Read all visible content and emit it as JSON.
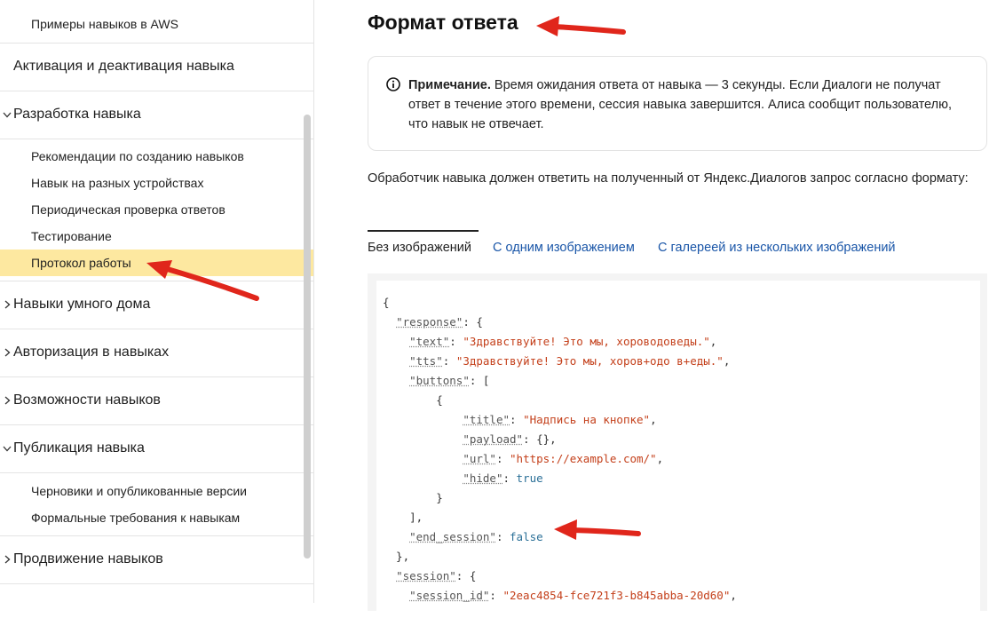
{
  "sidebar": {
    "items": [
      {
        "type": "sub",
        "label": "Примеры навыков в AWS",
        "active": false
      },
      {
        "type": "section",
        "label": "Активация и деактивация навыка",
        "chevron": "none"
      },
      {
        "type": "section",
        "label": "Разработка навыка",
        "chevron": "chevron-down"
      },
      {
        "type": "sub",
        "label": "Рекомендации по созданию навыков",
        "active": false
      },
      {
        "type": "sub",
        "label": "Навык на разных устройствах",
        "active": false
      },
      {
        "type": "sub",
        "label": "Периодическая проверка ответов",
        "active": false
      },
      {
        "type": "sub",
        "label": "Тестирование",
        "active": false
      },
      {
        "type": "sub",
        "label": "Протокол работы",
        "active": true
      },
      {
        "type": "section",
        "label": "Навыки умного дома",
        "chevron": "chevron-right"
      },
      {
        "type": "section",
        "label": "Авторизация в навыках",
        "chevron": "chevron-right"
      },
      {
        "type": "section",
        "label": "Возможности навыков",
        "chevron": "chevron-right"
      },
      {
        "type": "section",
        "label": "Публикация навыка",
        "chevron": "chevron-down"
      },
      {
        "type": "sub",
        "label": "Черновики и опубликованные версии",
        "active": false
      },
      {
        "type": "sub",
        "label": "Формальные требования к навыкам",
        "active": false
      },
      {
        "type": "section",
        "label": "Продвижение навыков",
        "chevron": "chevron-right"
      }
    ]
  },
  "main": {
    "title": "Формат ответа",
    "note": {
      "icon": "info-icon",
      "bold": "Примечание.",
      "text": " Время ожидания ответа от навыка — 3 секунды. Если Диалоги не получат ответ в течение этого времени, сессия навыка завершится. Алиса сообщит пользователю, что навык не отвечает."
    },
    "paragraph": "Обработчик навыка должен ответить на полученный от Яндекс.Диалогов запрос согласно формату:",
    "tabs": [
      "Без изображений",
      "С одним изображением",
      "С галереей из нескольких изображений"
    ],
    "selected_tab": "Без изображений",
    "code": {
      "open_brace": "{",
      "response_key": "\"response\"",
      "text_key": "\"text\"",
      "text_value": "\"Здравствуйте! Это мы, хороводоведы.\"",
      "tts_key": "\"tts\"",
      "tts_value": "\"Здравствуйте! Это мы, хоров+одо в+еды.\"",
      "buttons_key": "\"buttons\"",
      "title_key": "\"title\"",
      "title_value": "\"Надпись на кнопке\"",
      "payload_key": "\"payload\"",
      "url_key": "\"url\"",
      "url_value": "\"https://example.com/\"",
      "hide_key": "\"hide\"",
      "hide_value": "true",
      "end_session_key": "\"end_session\"",
      "end_session_value": "false",
      "session_key": "\"session\"",
      "session_id_key": "\"session_id\"",
      "session_id_value": "\"2eac4854-fce721f3-b845abba-20d60\""
    }
  },
  "colors": {
    "active_item_bg": "#fde8a0",
    "link": "#1a56a8",
    "string": "#c4401b",
    "boolean": "#2a6f97",
    "arrow": "#e0261b"
  }
}
